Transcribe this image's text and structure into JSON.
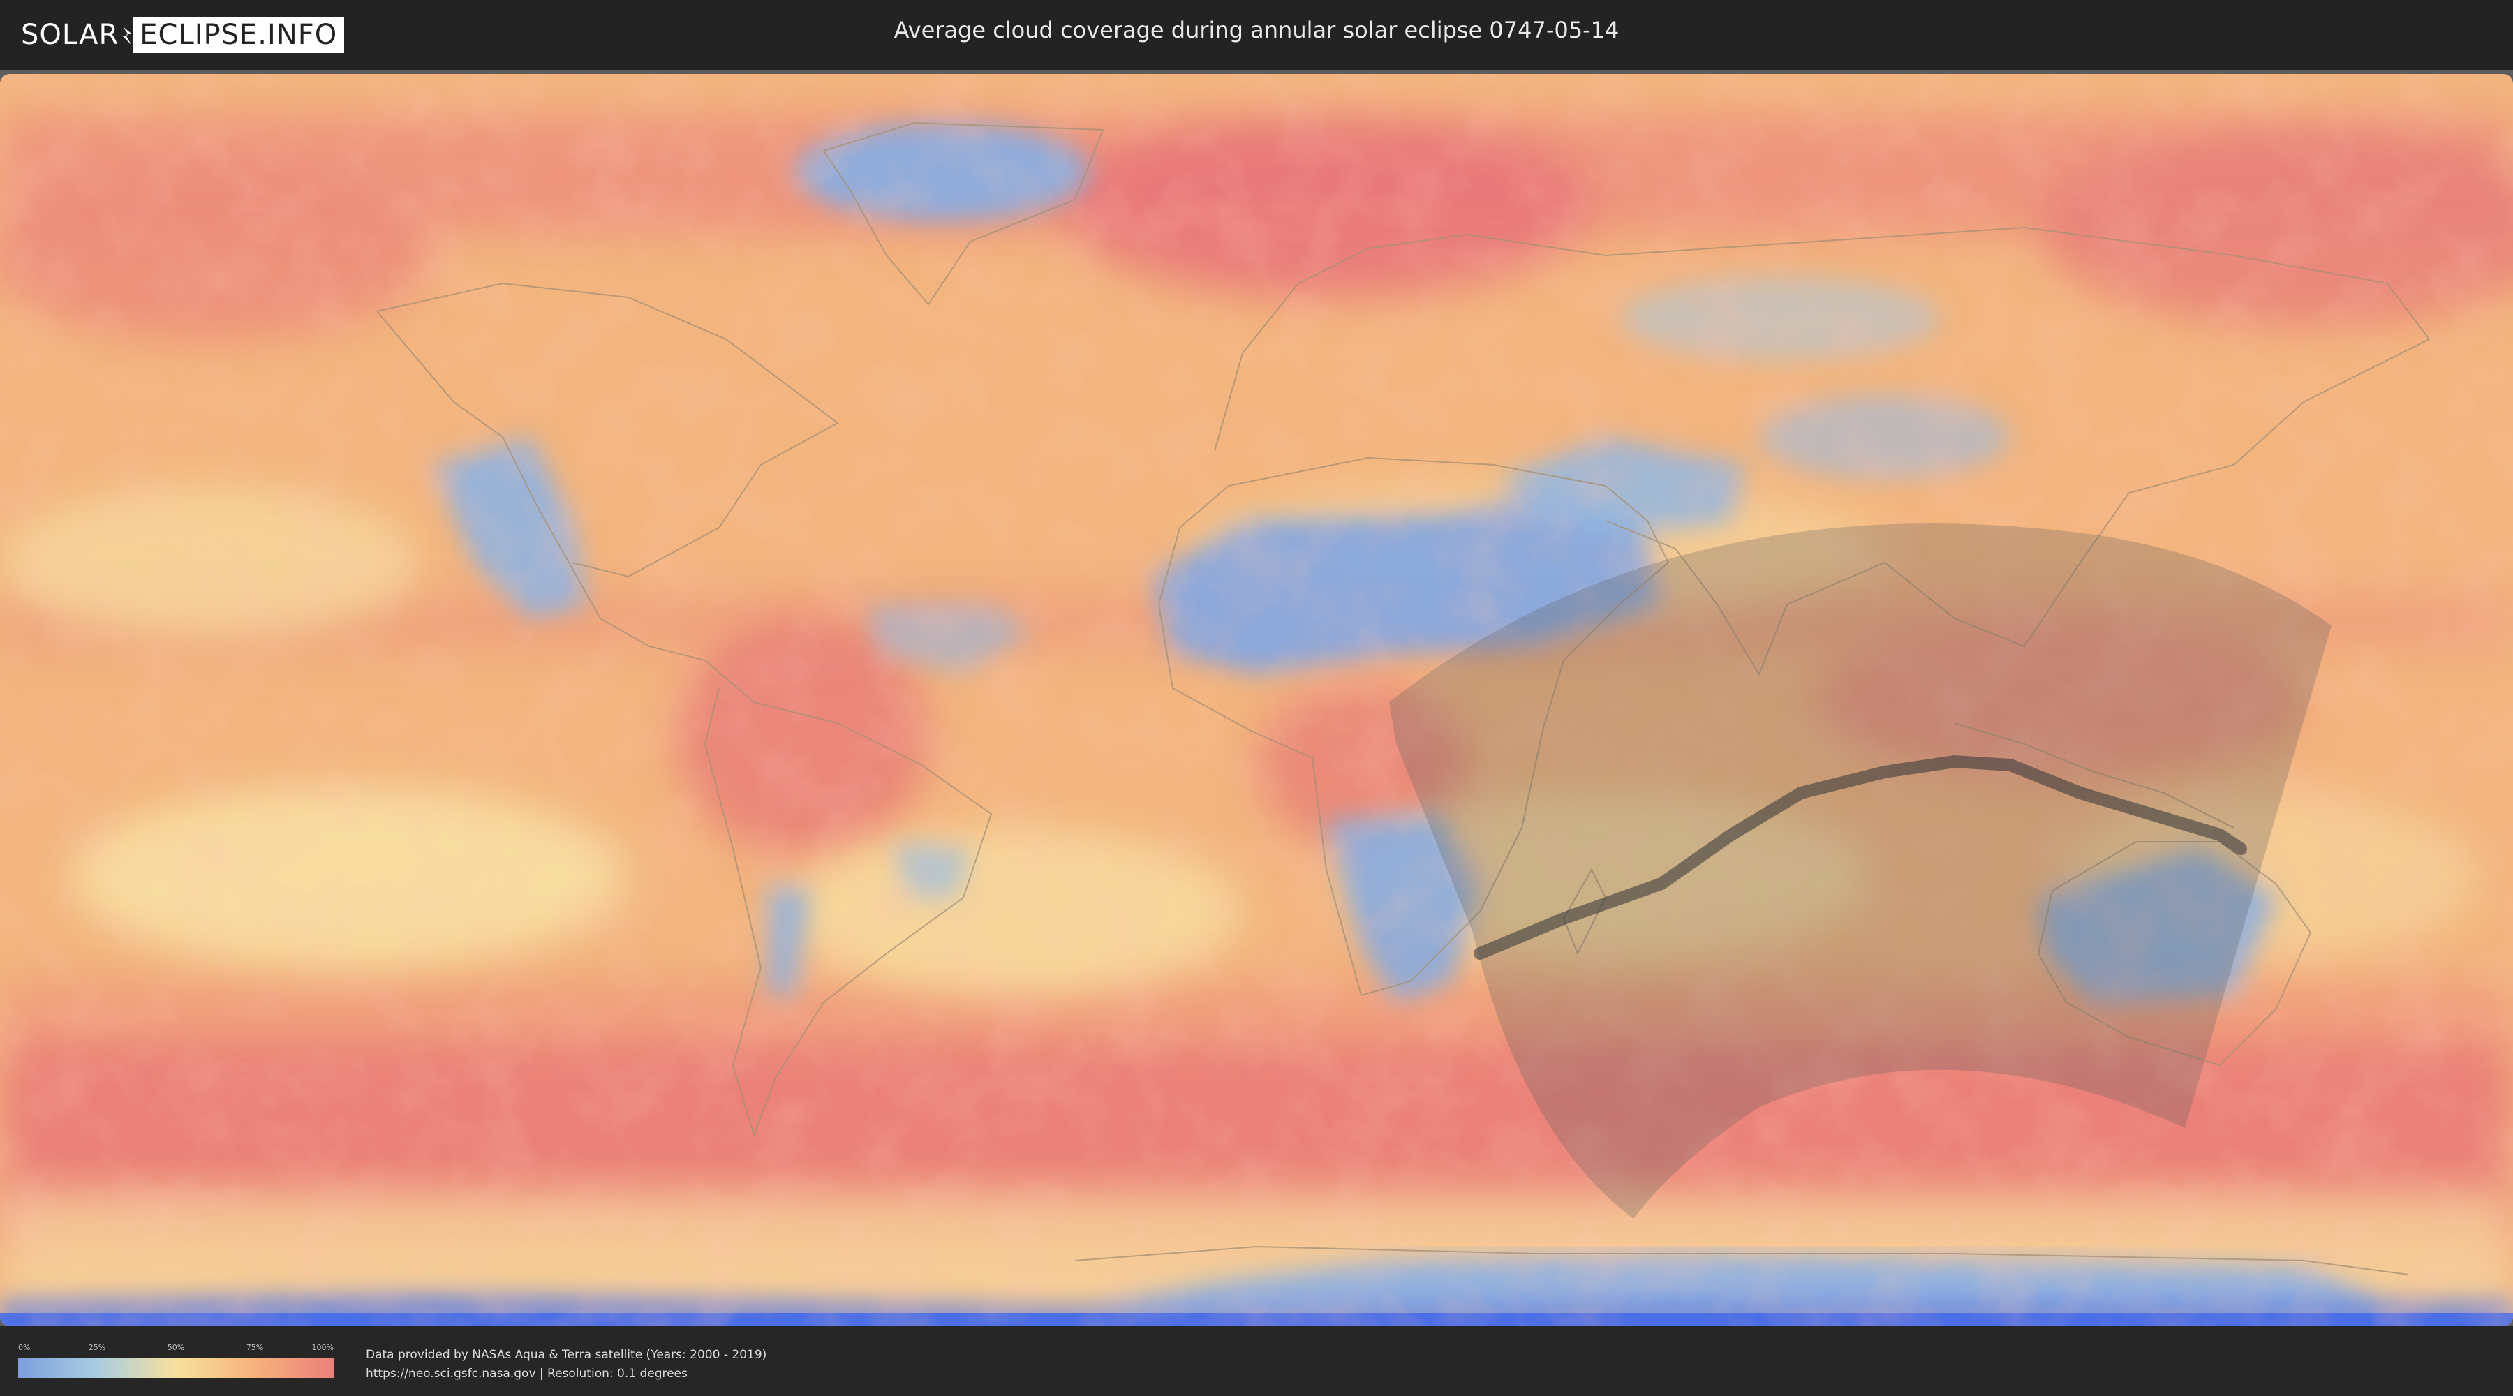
{
  "header": {
    "logo_left": "SOLAR",
    "logo_right": "ECLIPSE.INFO",
    "title": "Average cloud coverage during annular solar eclipse 0747-05-14"
  },
  "map": {
    "eclipse_type": "annular",
    "date": "0747-05-14",
    "colors": {
      "clear": "#7d9edf",
      "low": "#a9cde0",
      "medium": "#f7e09e",
      "high": "#f6b27d",
      "overcast": "#ec7f79",
      "ice": "#4a6ee6",
      "eclipse_zone": "#555555",
      "central_path": "#3c3c3c"
    }
  },
  "legend": {
    "ticks": [
      "0%",
      "25%",
      "50%",
      "75%",
      "100%"
    ]
  },
  "footer": {
    "credit_line1": "Data provided by NASAs Aqua & Terra satellite (Years: 2000 - 2019)",
    "credit_line2": "https://neo.sci.gsfc.nasa.gov | Resolution: 0.1 degrees"
  }
}
